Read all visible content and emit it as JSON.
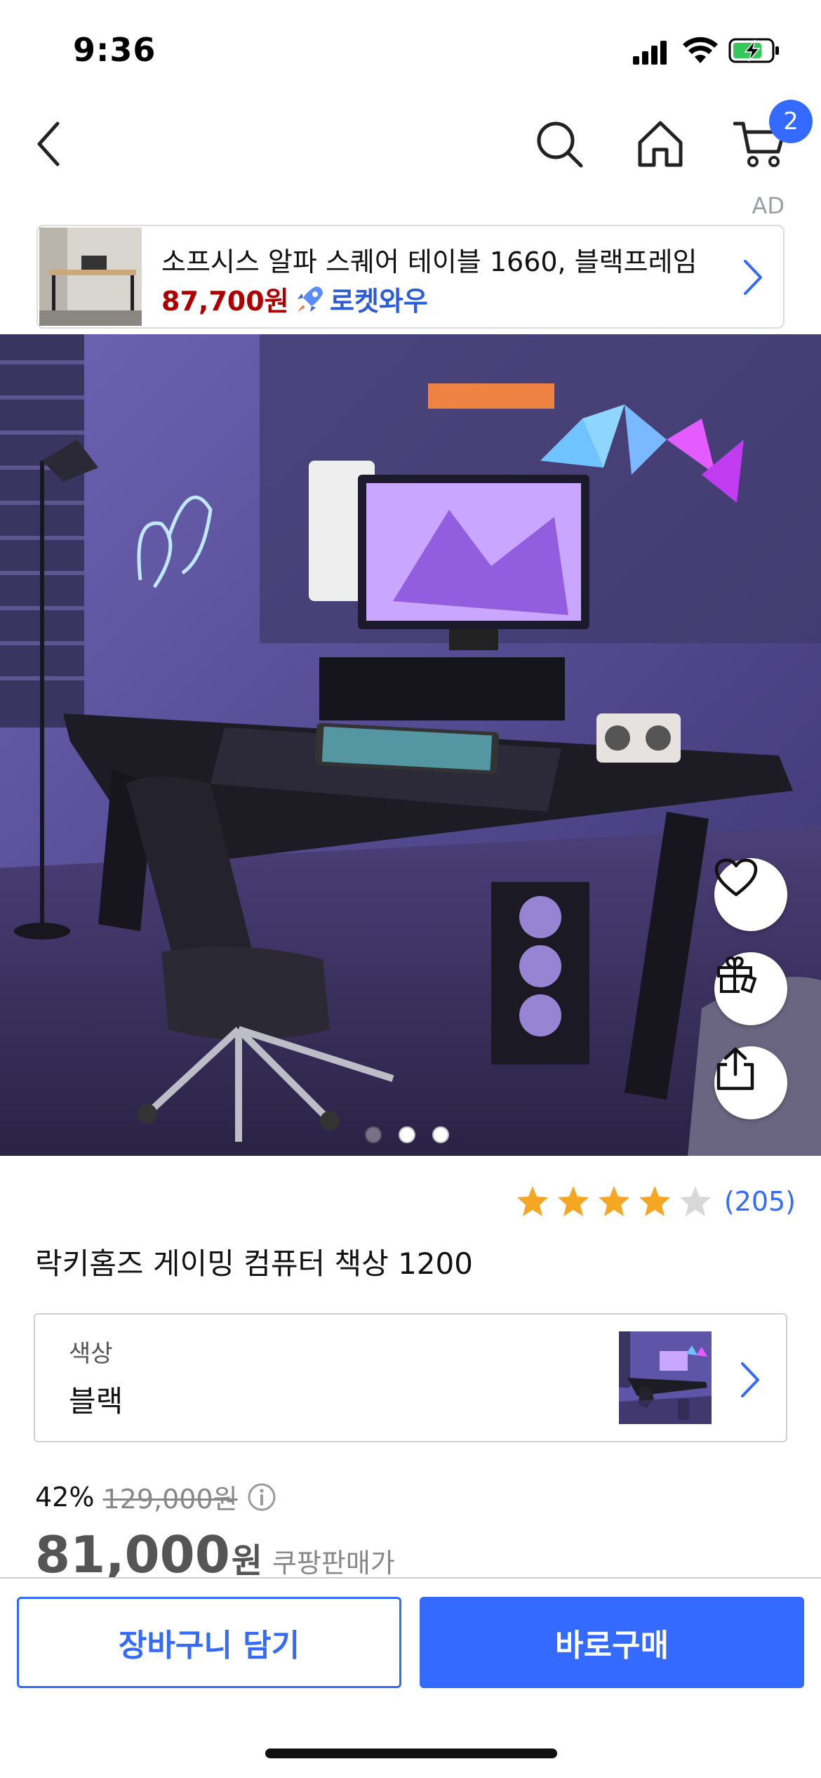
{
  "status_bar": {
    "time": "9:36"
  },
  "nav": {
    "cart_count": "2"
  },
  "ad": {
    "label": "AD",
    "title": "소프시스 알파 스퀘어 테이블 1660, 블랙프레임",
    "price": "87,700원",
    "badge": "로켓와우"
  },
  "gallery": {
    "image_count": 3,
    "active_index": 0
  },
  "rating": {
    "stars": 4,
    "count": "(205)"
  },
  "product": {
    "title": "락키홈즈 게이밍 컴퓨터 책상 1200"
  },
  "option": {
    "label": "색상",
    "value": "블랙"
  },
  "price": {
    "discount_rate": "42%",
    "original": "129,000원",
    "sale": "81,000",
    "sale_unit": "원",
    "seller_tag": "쿠팡판매가"
  },
  "actions": {
    "add_to_cart": "장바구니 담기",
    "buy_now": "바로구매"
  },
  "colors": {
    "accent": "#346aff",
    "price_red": "#ae0000",
    "star": "#f5a623"
  }
}
